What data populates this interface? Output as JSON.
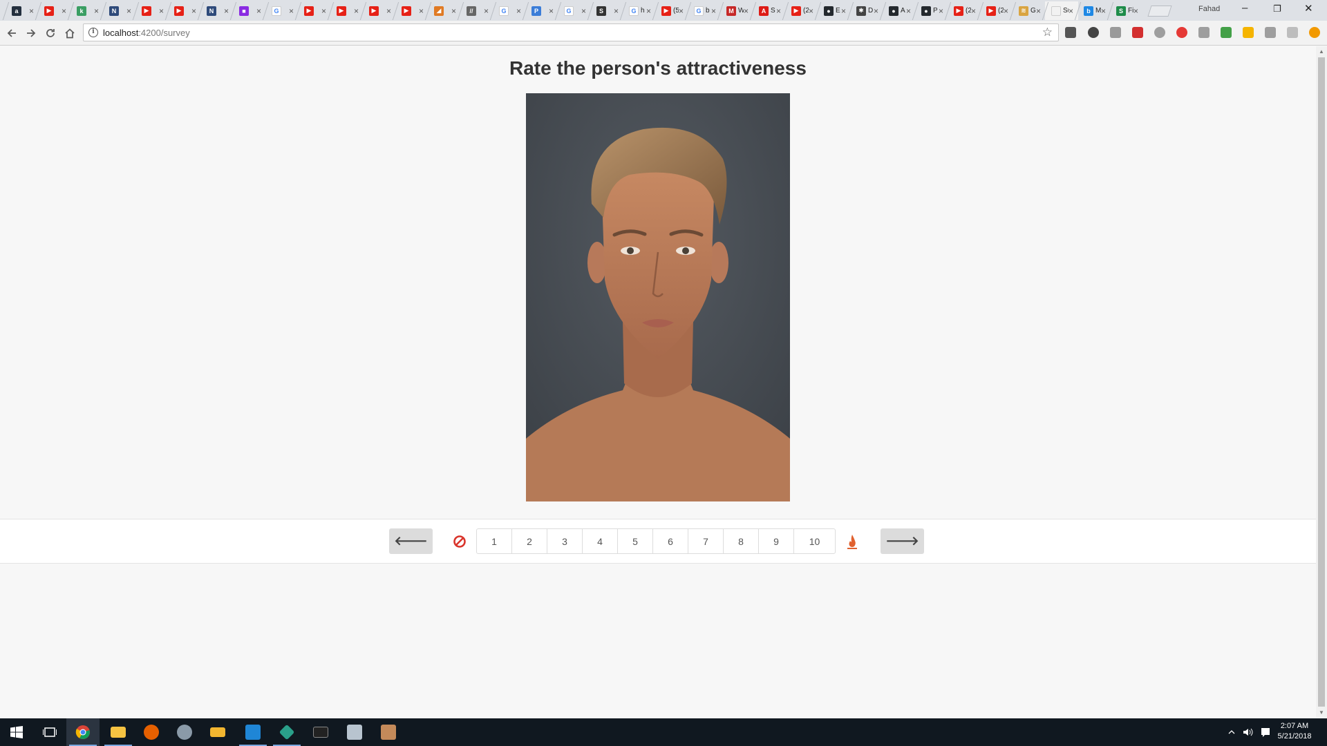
{
  "browser": {
    "tabs": [
      {
        "icon": "amazon-icon",
        "glyph": "a",
        "color": "#232f3e",
        "label": ""
      },
      {
        "icon": "youtube-icon",
        "glyph": "▶",
        "color": "#e62117",
        "label": ""
      },
      {
        "icon": "site-icon",
        "glyph": "k",
        "color": "#3a9e63",
        "label": ""
      },
      {
        "icon": "site-icon",
        "glyph": "N",
        "color": "#2e4a7a",
        "label": ""
      },
      {
        "icon": "youtube-icon",
        "glyph": "▶",
        "color": "#e62117",
        "label": ""
      },
      {
        "icon": "youtube-icon",
        "glyph": "▶",
        "color": "#e62117",
        "label": ""
      },
      {
        "icon": "site-icon",
        "glyph": "N",
        "color": "#2e4a7a",
        "label": ""
      },
      {
        "icon": "color-icon",
        "glyph": "■",
        "color": "#8a2be2",
        "label": ""
      },
      {
        "icon": "google-icon",
        "glyph": "G",
        "color": "#ffffff",
        "label": ""
      },
      {
        "icon": "youtube-icon",
        "glyph": "▶",
        "color": "#e62117",
        "label": ""
      },
      {
        "icon": "youtube-icon",
        "glyph": "▶",
        "color": "#e62117",
        "label": ""
      },
      {
        "icon": "youtube-icon",
        "glyph": "▶",
        "color": "#e62117",
        "label": ""
      },
      {
        "icon": "youtube-icon",
        "glyph": "▶",
        "color": "#e62117",
        "label": ""
      },
      {
        "icon": "site-icon",
        "glyph": "◢",
        "color": "#e07a24",
        "label": ""
      },
      {
        "icon": "site-icon",
        "glyph": "//",
        "color": "#666666",
        "label": ""
      },
      {
        "icon": "google-icon",
        "glyph": "G",
        "color": "#ffffff",
        "label": ""
      },
      {
        "icon": "site-icon",
        "glyph": "P",
        "color": "#3b7dd8",
        "label": ""
      },
      {
        "icon": "google-icon",
        "glyph": "G",
        "color": "#ffffff",
        "label": ""
      },
      {
        "icon": "site-icon",
        "glyph": "S",
        "color": "#333333",
        "label": ""
      },
      {
        "icon": "google-icon",
        "glyph": "G",
        "color": "#ffffff",
        "label": "h"
      },
      {
        "icon": "youtube-icon",
        "glyph": "▶",
        "color": "#e62117",
        "label": "(5"
      },
      {
        "icon": "google-icon",
        "glyph": "G",
        "color": "#ffffff",
        "label": "b"
      },
      {
        "icon": "site-icon",
        "glyph": "M",
        "color": "#c62828",
        "label": "W"
      },
      {
        "icon": "angular-icon",
        "glyph": "A",
        "color": "#dd1b16",
        "label": "S"
      },
      {
        "icon": "youtube-icon",
        "glyph": "▶",
        "color": "#e62117",
        "label": "(2"
      },
      {
        "icon": "github-icon",
        "glyph": "●",
        "color": "#24292e",
        "label": "E"
      },
      {
        "icon": "site-icon",
        "glyph": "✱",
        "color": "#444444",
        "label": "D"
      },
      {
        "icon": "github-icon",
        "glyph": "●",
        "color": "#24292e",
        "label": "A"
      },
      {
        "icon": "github-icon",
        "glyph": "●",
        "color": "#24292e",
        "label": "P"
      },
      {
        "icon": "youtube-icon",
        "glyph": "▶",
        "color": "#e62117",
        "label": "(2"
      },
      {
        "icon": "youtube-icon",
        "glyph": "▶",
        "color": "#e62117",
        "label": "(2"
      },
      {
        "icon": "site-icon",
        "glyph": "≋",
        "color": "#d9a441",
        "label": "G"
      },
      {
        "icon": "site-icon",
        "glyph": "",
        "color": "#f2f2f2",
        "label": "Su"
      },
      {
        "icon": "site-icon",
        "glyph": "b",
        "color": "#1e88e5",
        "label": "M"
      },
      {
        "icon": "site-icon",
        "glyph": "S",
        "color": "#1e8c4a",
        "label": "Fi"
      }
    ],
    "active_tab_index": 32,
    "profile_name": "Fahad",
    "window_controls": {
      "minimize": "–",
      "restore": "❐",
      "close": "✕"
    },
    "url_host": "localhost",
    "url_path": ":4200/survey"
  },
  "survey": {
    "title": "Rate the person's attractiveness",
    "prev_glyph": "🡐",
    "next_glyph": "🡒",
    "ratings": [
      "1",
      "2",
      "3",
      "4",
      "5",
      "6",
      "7",
      "8",
      "9",
      "10"
    ],
    "colors": {
      "skip": "#d9342b",
      "fire": "#e0612f",
      "button_bg": "#dcdcdc"
    }
  },
  "taskbar": {
    "time": "2:07 AM",
    "date": "5/21/2018"
  }
}
